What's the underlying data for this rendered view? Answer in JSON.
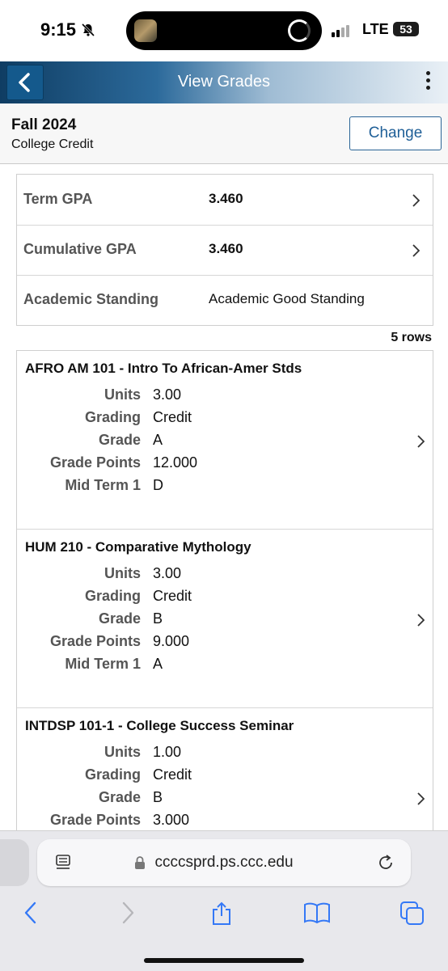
{
  "status_bar": {
    "time": "9:15",
    "network": "LTE",
    "battery": "53"
  },
  "header": {
    "title": "View Grades"
  },
  "term": {
    "name": "Fall 2024",
    "career": "College Credit",
    "change_label": "Change"
  },
  "gpa": [
    {
      "label": "Term GPA",
      "value": "3.460"
    },
    {
      "label": "Cumulative GPA",
      "value": "3.460"
    },
    {
      "label": "Academic Standing",
      "value": "Academic Good Standing"
    }
  ],
  "rows_count": "5 rows",
  "field_labels": {
    "units": "Units",
    "grading": "Grading",
    "grade": "Grade",
    "grade_points": "Grade Points",
    "mid_term": "Mid Term 1"
  },
  "classes": [
    {
      "title": "AFRO AM 101 - Intro To African-Amer Stds",
      "units": "3.00",
      "grading": "Credit",
      "grade": "A",
      "grade_points": "12.000",
      "mid_term": "D"
    },
    {
      "title": "HUM 210 - Comparative Mythology",
      "units": "3.00",
      "grading": "Credit",
      "grade": "B",
      "grade_points": "9.000",
      "mid_term": "A"
    },
    {
      "title": "INTDSP 101-1 - College Success Seminar",
      "units": "1.00",
      "grading": "Credit",
      "grade": "B",
      "grade_points": "3.000"
    }
  ],
  "browser": {
    "url": "ccccsprd.ps.ccc.edu"
  },
  "colors": {
    "header_dark": "#0f3d63",
    "accent_blue": "#1f5f97",
    "toolbar_icon": "#3478f6"
  },
  "icons": [
    "back-chevron-icon",
    "more-vertical-icon",
    "chevron-right-icon",
    "lock-icon",
    "reader-icon",
    "reload-icon",
    "share-icon",
    "bookmarks-icon",
    "tabs-icon",
    "bell-slash-icon"
  ]
}
